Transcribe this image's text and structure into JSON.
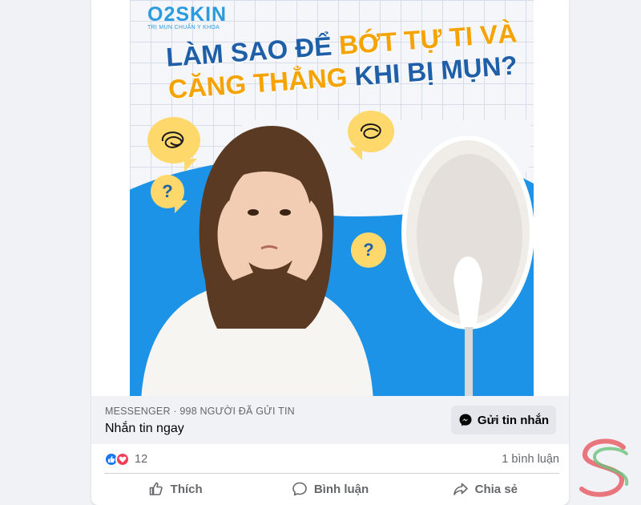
{
  "ad": {
    "brand_name": "O2SKIN",
    "brand_tagline": "TRỊ MỤN CHUẨN Y KHOA",
    "headline_part1": "LÀM SAO ĐỂ ",
    "headline_accent": "BỚT TỰ TI VÀ",
    "headline_part2": "CĂNG THẲNG ",
    "headline_part3": "KHI BỊ MỤN?",
    "bubble_question": "?"
  },
  "sponsor": {
    "source": "MESSENGER · 998 NGƯỜI ĐÃ GỬI TIN",
    "cta": "Nhắn tin ngay",
    "button_label": "Gửi tin nhắn"
  },
  "stats": {
    "reaction_count": "12",
    "comment_count": "1 bình luận"
  },
  "actions": {
    "like": "Thích",
    "comment": "Bình luận",
    "share": "Chia sẻ"
  },
  "colors": {
    "brand_blue": "#2b9be0",
    "accent_orange": "#f5a300",
    "fb_blue": "#1877f2",
    "love_red": "#f33e58"
  },
  "icons": [
    "like-icon",
    "love-icon",
    "messenger-icon",
    "thumb-up-icon",
    "comment-icon",
    "share-icon"
  ]
}
